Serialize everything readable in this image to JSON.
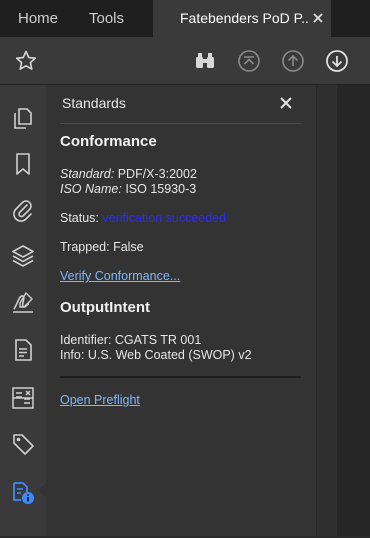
{
  "tabs": {
    "home": "Home",
    "tools": "Tools",
    "document": "Fatebenders PoD P..."
  },
  "toolbar": {
    "icons": [
      "star-icon",
      "find-icon",
      "prev-page-icon",
      "page-up-icon",
      "page-down-icon"
    ]
  },
  "sidebar": {
    "icons": [
      "pages-icon",
      "bookmark-icon",
      "attachment-icon",
      "layers-icon",
      "signature-icon",
      "document-properties-icon",
      "compare-icon",
      "tags-icon",
      "standards-icon"
    ]
  },
  "panel": {
    "title": "Standards",
    "conformance": {
      "heading": "Conformance",
      "standard_label": "Standard:",
      "standard_value": "PDF/X-3:2002",
      "iso_label": "ISO Name:",
      "iso_value": "ISO 15930-3",
      "status_label": "Status:",
      "status_value": "verification succeeded",
      "trapped_label": "Trapped:",
      "trapped_value": "False",
      "verify_link": "Verify Conformance..."
    },
    "output_intent": {
      "heading": "OutputIntent",
      "identifier_label": "Identifier:",
      "identifier_value": "CGATS TR 001",
      "info_label": "Info:",
      "info_value": "U.S. Web Coated (SWOP) v2"
    },
    "preflight_link": "Open Preflight"
  },
  "colors": {
    "status_ok": "#2b2bff",
    "link": "#7fb8ff",
    "accent_icon": "#3d8bff"
  }
}
